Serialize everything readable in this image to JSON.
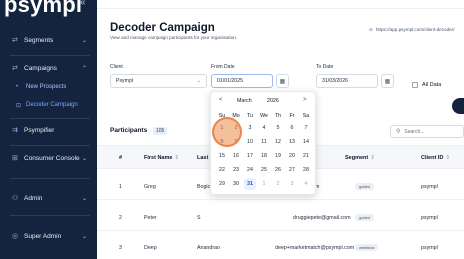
{
  "sidebar": {
    "logo": "psympl",
    "collapse_icon": "«",
    "items": [
      {
        "label": "Segments",
        "icon": "segments-icon",
        "glyph": "⇄"
      },
      {
        "label": "Campaigns",
        "icon": "campaigns-icon",
        "glyph": "⇄"
      },
      {
        "label": "New Prospects",
        "glyph": "•"
      },
      {
        "label": "Decoder Campaign",
        "glyph": "⊡"
      },
      {
        "label": "Psympifier",
        "icon": "psympifier-icon",
        "glyph": "⇉"
      },
      {
        "label": "Consumer Console",
        "icon": "console-icon",
        "glyph": "⊞"
      },
      {
        "label": "Admin",
        "icon": "admin-icon",
        "glyph": "⚇"
      },
      {
        "label": "Super Admin",
        "icon": "super-admin-icon",
        "glyph": "◎"
      }
    ],
    "active_color": "#7ba4ff",
    "bg": "#14243f"
  },
  "header": {
    "title": "Decoder Campaign",
    "subtitle": "View and manage campaign participants for your organisation.",
    "url": "https://app.psympl.com/client-decoder/"
  },
  "filters": {
    "client_label": "Client",
    "client_value": "Psympl",
    "from_label": "From Date",
    "from_value": "01/01/2025",
    "to_label": "To Date",
    "to_value": "31/03/2026",
    "all_data_label": "All Data"
  },
  "calendar": {
    "month": "March",
    "year": "2026",
    "prev": "<",
    "next": ">",
    "weekdays": [
      "Su",
      "Mo",
      "Tu",
      "We",
      "Th",
      "Fr",
      "Sa"
    ],
    "weeks": [
      [
        "1",
        "2",
        "3",
        "4",
        "5",
        "6",
        "7"
      ],
      [
        "8",
        "9",
        "10",
        "11",
        "12",
        "13",
        "14"
      ],
      [
        "15",
        "16",
        "17",
        "18",
        "19",
        "20",
        "21"
      ],
      [
        "22",
        "23",
        "24",
        "25",
        "26",
        "27",
        "28"
      ],
      [
        "29",
        "30",
        "31",
        "1",
        "2",
        "3",
        "4"
      ]
    ],
    "selected": "31"
  },
  "table": {
    "title": "Participants",
    "count": "105",
    "search_placeholder": "Search...",
    "columns": [
      "#",
      "First Name",
      "Last N",
      "Segment",
      "Client ID"
    ],
    "rows": [
      {
        "n": "1",
        "first": "Greg",
        "last": "Bogic",
        "email": "m",
        "segment": "guided",
        "client": "psympl"
      },
      {
        "n": "2",
        "first": "Peter",
        "last": "S",
        "email": "druggiepete@gmail.com",
        "segment": "guided",
        "client": "psympl"
      },
      {
        "n": "3",
        "first": "Deep",
        "last": "Anandrao",
        "email": "deep+marketmatch@psympl.com",
        "segment": "ambitious",
        "client": "psympl"
      }
    ]
  }
}
